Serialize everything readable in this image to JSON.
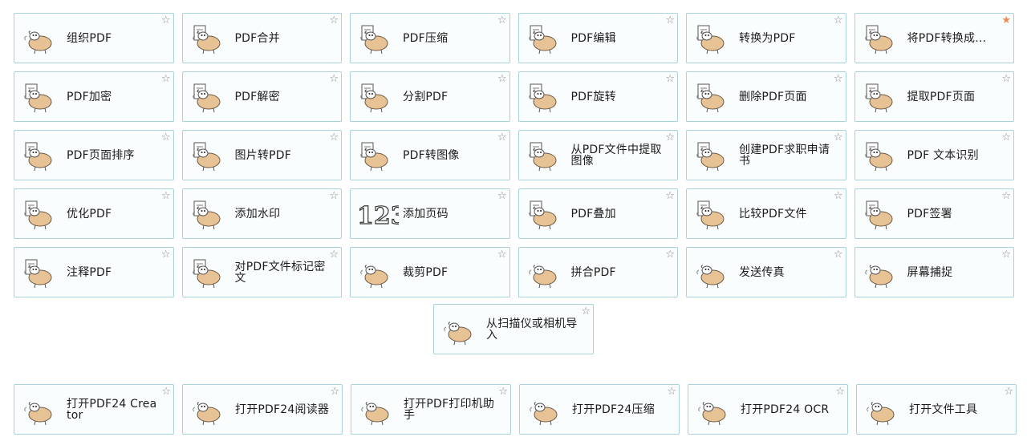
{
  "tools": [
    [
      {
        "label": "组织PDF",
        "icon": "sheep-icon",
        "starred": false
      },
      {
        "label": "PDF合并",
        "icon": "merge-sheep-icon",
        "starred": false
      },
      {
        "label": "PDF压缩",
        "icon": "compress-sheep-icon",
        "starred": false
      },
      {
        "label": "PDF编辑",
        "icon": "edit-sheep-icon",
        "starred": false
      },
      {
        "label": "转换为PDF",
        "icon": "convert-sheep-icon",
        "starred": false
      },
      {
        "label": "将PDF转换成…",
        "icon": "convert-from-sheep-icon",
        "starred": true
      }
    ],
    [
      {
        "label": "PDF加密",
        "icon": "lock-sheep-icon",
        "starred": false
      },
      {
        "label": "PDF解密",
        "icon": "unlock-sheep-icon",
        "starred": false
      },
      {
        "label": "分割PDF",
        "icon": "split-sheep-icon",
        "starred": false
      },
      {
        "label": "PDF旋转",
        "icon": "rotate-sheep-icon",
        "starred": false
      },
      {
        "label": "删除PDF页面",
        "icon": "delete-pages-sheep-icon",
        "starred": false
      },
      {
        "label": "提取PDF页面",
        "icon": "extract-pages-sheep-icon",
        "starred": false
      }
    ],
    [
      {
        "label": "PDF页面排序",
        "icon": "sort-pages-sheep-icon",
        "starred": false
      },
      {
        "label": "图片转PDF",
        "icon": "image-to-pdf-sheep-icon",
        "starred": false
      },
      {
        "label": "PDF转图像",
        "icon": "pdf-to-image-sheep-icon",
        "starred": false
      },
      {
        "label": "从PDF文件中提取图像",
        "icon": "extract-images-sheep-icon",
        "starred": false
      },
      {
        "label": "创建PDF求职申请书",
        "icon": "job-application-sheep-icon",
        "starred": false
      },
      {
        "label": "PDF 文本识别",
        "icon": "ocr-sheep-icon",
        "starred": false
      }
    ],
    [
      {
        "label": "优化PDF",
        "icon": "optimize-sheep-icon",
        "starred": false
      },
      {
        "label": "添加水印",
        "icon": "watermark-sheep-icon",
        "starred": false
      },
      {
        "label": "添加页码",
        "icon": "page-numbers-icon",
        "starred": false
      },
      {
        "label": "PDF叠加",
        "icon": "overlay-sheep-icon",
        "starred": false
      },
      {
        "label": "比较PDF文件",
        "icon": "compare-sheep-icon",
        "starred": false
      },
      {
        "label": "PDF签署",
        "icon": "sign-sheep-icon",
        "starred": false
      }
    ],
    [
      {
        "label": "注释PDF",
        "icon": "annotate-sheep-icon",
        "starred": false
      },
      {
        "label": "对PDF文件标记密文",
        "icon": "redact-sheep-icon",
        "starred": false
      },
      {
        "label": "裁剪PDF",
        "icon": "sheep-icon",
        "starred": false
      },
      {
        "label": "拼合PDF",
        "icon": "sheep-icon",
        "starred": false
      },
      {
        "label": "发送传真",
        "icon": "sheep-icon",
        "starred": false
      },
      {
        "label": "屏幕捕捉",
        "icon": "sheep-icon",
        "starred": false
      }
    ]
  ],
  "center_tool": {
    "label": "从扫描仪或相机导入",
    "icon": "sheep-icon",
    "starred": false
  },
  "open_tools": [
    {
      "label": "打开PDF24 Creator",
      "icon": "sheep-icon",
      "starred": false
    },
    {
      "label": "打开PDF24阅读器",
      "icon": "sheep-icon",
      "starred": false
    },
    {
      "label": "打开PDF打印机助手",
      "icon": "sheep-icon",
      "starred": false
    },
    {
      "label": "打开PDF24压缩",
      "icon": "sheep-icon",
      "starred": false
    },
    {
      "label": "打开PDF24 OCR",
      "icon": "sheep-icon",
      "starred": false
    },
    {
      "label": "打开文件工具",
      "icon": "sheep-icon",
      "starred": false
    }
  ],
  "colors": {
    "tile_border": "#a9d2dc",
    "star": "#8a8a8a",
    "star_favorite": "#e98d55",
    "sheep_body": "#e7c294"
  },
  "star_glyphs": {
    "empty": "☆",
    "filled": "★"
  }
}
